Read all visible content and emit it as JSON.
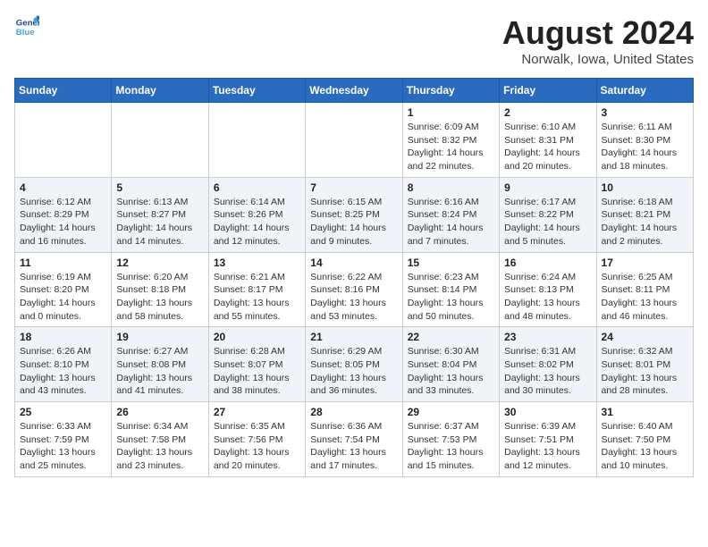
{
  "header": {
    "logo_line1": "General",
    "logo_line2": "Blue",
    "month": "August 2024",
    "location": "Norwalk, Iowa, United States"
  },
  "weekdays": [
    "Sunday",
    "Monday",
    "Tuesday",
    "Wednesday",
    "Thursday",
    "Friday",
    "Saturday"
  ],
  "weeks": [
    [
      {
        "day": "",
        "info": ""
      },
      {
        "day": "",
        "info": ""
      },
      {
        "day": "",
        "info": ""
      },
      {
        "day": "",
        "info": ""
      },
      {
        "day": "1",
        "info": "Sunrise: 6:09 AM\nSunset: 8:32 PM\nDaylight: 14 hours\nand 22 minutes."
      },
      {
        "day": "2",
        "info": "Sunrise: 6:10 AM\nSunset: 8:31 PM\nDaylight: 14 hours\nand 20 minutes."
      },
      {
        "day": "3",
        "info": "Sunrise: 6:11 AM\nSunset: 8:30 PM\nDaylight: 14 hours\nand 18 minutes."
      }
    ],
    [
      {
        "day": "4",
        "info": "Sunrise: 6:12 AM\nSunset: 8:29 PM\nDaylight: 14 hours\nand 16 minutes."
      },
      {
        "day": "5",
        "info": "Sunrise: 6:13 AM\nSunset: 8:27 PM\nDaylight: 14 hours\nand 14 minutes."
      },
      {
        "day": "6",
        "info": "Sunrise: 6:14 AM\nSunset: 8:26 PM\nDaylight: 14 hours\nand 12 minutes."
      },
      {
        "day": "7",
        "info": "Sunrise: 6:15 AM\nSunset: 8:25 PM\nDaylight: 14 hours\nand 9 minutes."
      },
      {
        "day": "8",
        "info": "Sunrise: 6:16 AM\nSunset: 8:24 PM\nDaylight: 14 hours\nand 7 minutes."
      },
      {
        "day": "9",
        "info": "Sunrise: 6:17 AM\nSunset: 8:22 PM\nDaylight: 14 hours\nand 5 minutes."
      },
      {
        "day": "10",
        "info": "Sunrise: 6:18 AM\nSunset: 8:21 PM\nDaylight: 14 hours\nand 2 minutes."
      }
    ],
    [
      {
        "day": "11",
        "info": "Sunrise: 6:19 AM\nSunset: 8:20 PM\nDaylight: 14 hours\nand 0 minutes."
      },
      {
        "day": "12",
        "info": "Sunrise: 6:20 AM\nSunset: 8:18 PM\nDaylight: 13 hours\nand 58 minutes."
      },
      {
        "day": "13",
        "info": "Sunrise: 6:21 AM\nSunset: 8:17 PM\nDaylight: 13 hours\nand 55 minutes."
      },
      {
        "day": "14",
        "info": "Sunrise: 6:22 AM\nSunset: 8:16 PM\nDaylight: 13 hours\nand 53 minutes."
      },
      {
        "day": "15",
        "info": "Sunrise: 6:23 AM\nSunset: 8:14 PM\nDaylight: 13 hours\nand 50 minutes."
      },
      {
        "day": "16",
        "info": "Sunrise: 6:24 AM\nSunset: 8:13 PM\nDaylight: 13 hours\nand 48 minutes."
      },
      {
        "day": "17",
        "info": "Sunrise: 6:25 AM\nSunset: 8:11 PM\nDaylight: 13 hours\nand 46 minutes."
      }
    ],
    [
      {
        "day": "18",
        "info": "Sunrise: 6:26 AM\nSunset: 8:10 PM\nDaylight: 13 hours\nand 43 minutes."
      },
      {
        "day": "19",
        "info": "Sunrise: 6:27 AM\nSunset: 8:08 PM\nDaylight: 13 hours\nand 41 minutes."
      },
      {
        "day": "20",
        "info": "Sunrise: 6:28 AM\nSunset: 8:07 PM\nDaylight: 13 hours\nand 38 minutes."
      },
      {
        "day": "21",
        "info": "Sunrise: 6:29 AM\nSunset: 8:05 PM\nDaylight: 13 hours\nand 36 minutes."
      },
      {
        "day": "22",
        "info": "Sunrise: 6:30 AM\nSunset: 8:04 PM\nDaylight: 13 hours\nand 33 minutes."
      },
      {
        "day": "23",
        "info": "Sunrise: 6:31 AM\nSunset: 8:02 PM\nDaylight: 13 hours\nand 30 minutes."
      },
      {
        "day": "24",
        "info": "Sunrise: 6:32 AM\nSunset: 8:01 PM\nDaylight: 13 hours\nand 28 minutes."
      }
    ],
    [
      {
        "day": "25",
        "info": "Sunrise: 6:33 AM\nSunset: 7:59 PM\nDaylight: 13 hours\nand 25 minutes."
      },
      {
        "day": "26",
        "info": "Sunrise: 6:34 AM\nSunset: 7:58 PM\nDaylight: 13 hours\nand 23 minutes."
      },
      {
        "day": "27",
        "info": "Sunrise: 6:35 AM\nSunset: 7:56 PM\nDaylight: 13 hours\nand 20 minutes."
      },
      {
        "day": "28",
        "info": "Sunrise: 6:36 AM\nSunset: 7:54 PM\nDaylight: 13 hours\nand 17 minutes."
      },
      {
        "day": "29",
        "info": "Sunrise: 6:37 AM\nSunset: 7:53 PM\nDaylight: 13 hours\nand 15 minutes."
      },
      {
        "day": "30",
        "info": "Sunrise: 6:39 AM\nSunset: 7:51 PM\nDaylight: 13 hours\nand 12 minutes."
      },
      {
        "day": "31",
        "info": "Sunrise: 6:40 AM\nSunset: 7:50 PM\nDaylight: 13 hours\nand 10 minutes."
      }
    ]
  ]
}
